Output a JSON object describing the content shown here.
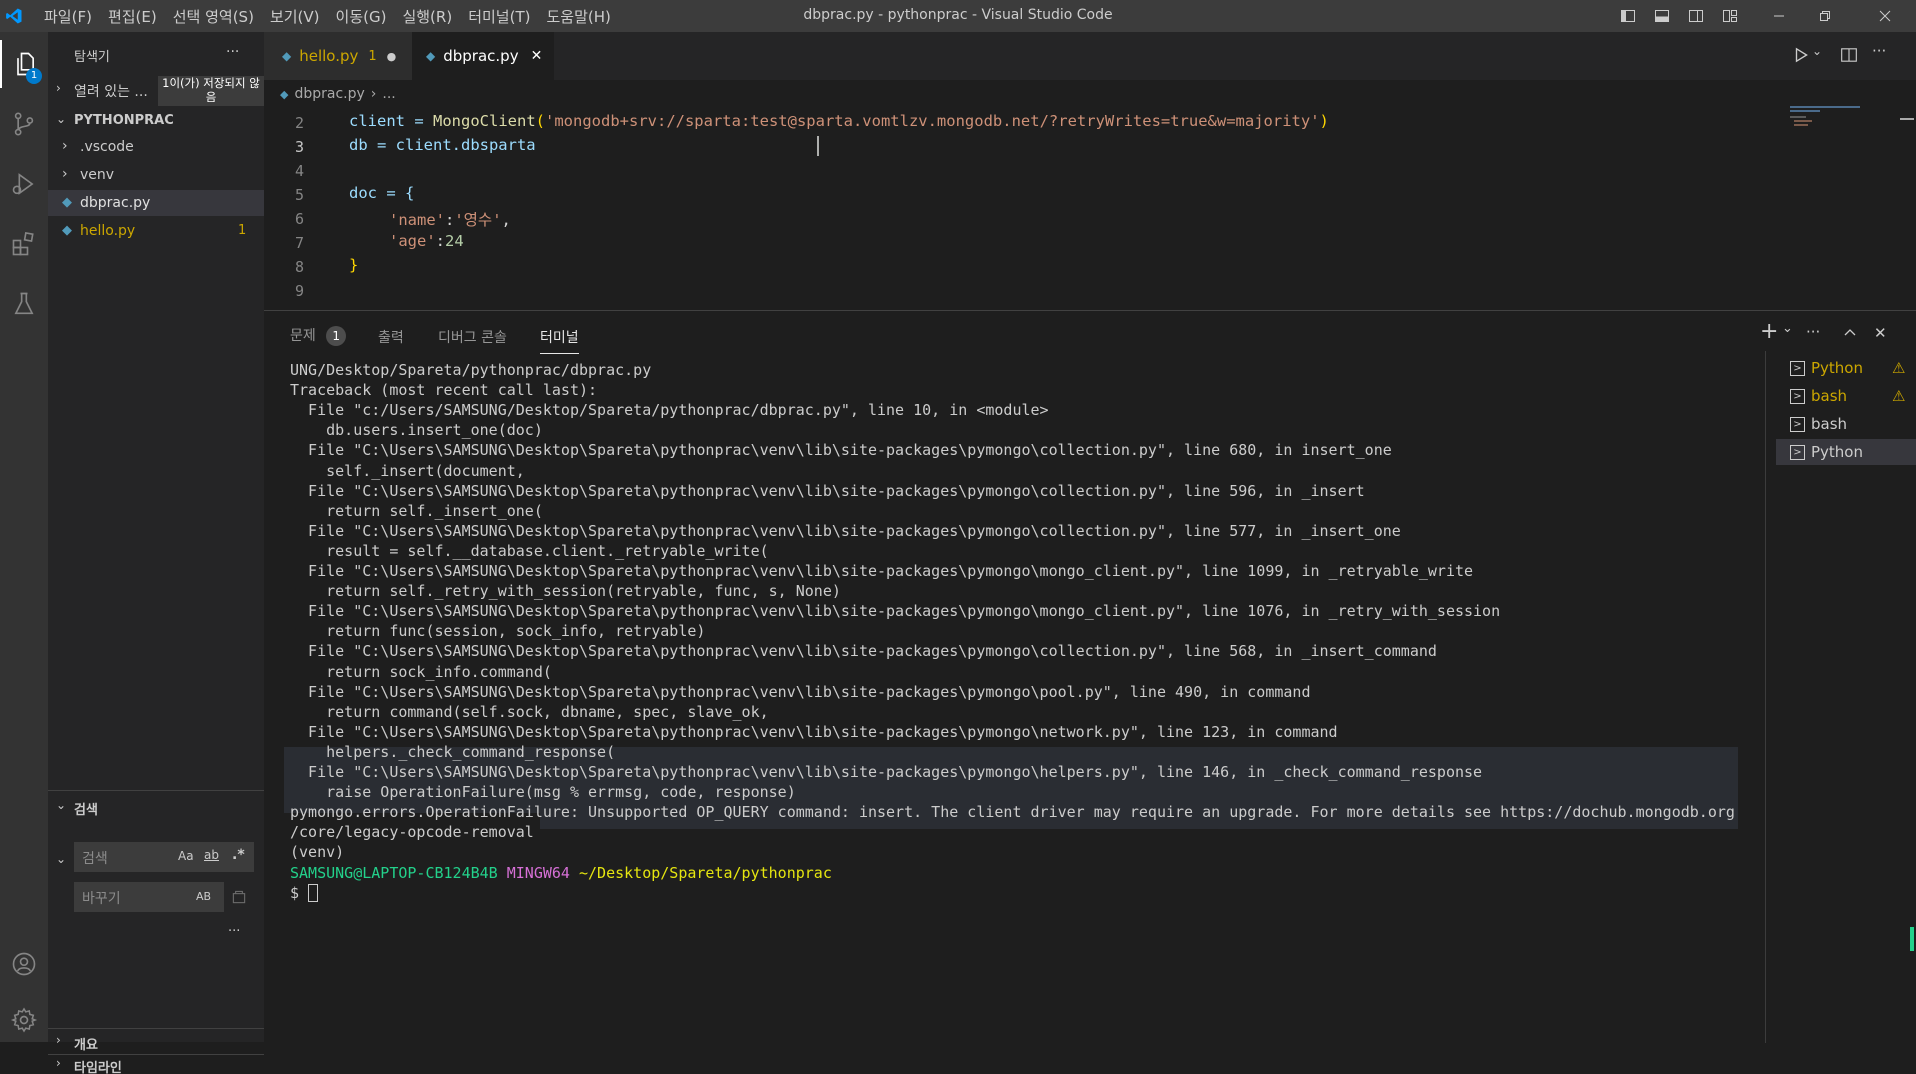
{
  "titlebar": {
    "menus": [
      "파일(F)",
      "편집(E)",
      "선택 영역(S)",
      "보기(V)",
      "이동(G)",
      "실행(R)",
      "터미널(T)",
      "도움말(H)"
    ],
    "title": "dbprac.py - pythonprac - Visual Studio Code"
  },
  "activity": {
    "explorer_badge": "1"
  },
  "sidebar": {
    "header": "탐색기",
    "more": "···",
    "open_editors": "열려 있는 ...",
    "unsaved_tooltip": "1이(가) 저장되지 않음",
    "project": "PYTHONPRAC",
    "items": [
      {
        "label": ".vscode"
      },
      {
        "label": "venv"
      },
      {
        "label": "dbprac.py"
      },
      {
        "label": "hello.py",
        "badge": "1"
      }
    ],
    "search": {
      "title": "검색",
      "search_placeholder": "검색",
      "replace_placeholder": "바꾸기",
      "case_label": "Aa",
      "word_label": "ab",
      "regex_label": ".*",
      "preserve_label": "AB",
      "more": "···"
    },
    "outline": "개요",
    "timeline": "타임라인"
  },
  "tabs": [
    {
      "label": "hello.py",
      "badge": "1",
      "modified": "●"
    },
    {
      "label": "dbprac.py",
      "close": "✕"
    }
  ],
  "breadcrumb": {
    "file": "dbprac.py",
    "rest": "..."
  },
  "editor": {
    "lines": [
      {
        "n": "2",
        "a": "client = ",
        "b": "MongoClient",
        "c": "(",
        "d": "'mongodb+srv://sparta:test@sparta.vomtlzv.mongodb.net/?retryWrites=true&w=majority'",
        "e": ")"
      },
      {
        "n": "3",
        "text": "db = client.dbsparta"
      },
      {
        "n": "4"
      },
      {
        "n": "5",
        "text": "doc = {"
      },
      {
        "n": "6",
        "key": "'name'",
        "sep": ":",
        "val": "'영수'",
        "tail": ","
      },
      {
        "n": "7",
        "key": "'age'",
        "sep": ":",
        "val": "24"
      },
      {
        "n": "8",
        "text": "}"
      },
      {
        "n": "9"
      }
    ]
  },
  "panel": {
    "tabs": [
      "문제",
      "출력",
      "디버그 콘솔",
      "터미널"
    ],
    "problems_badge": "1",
    "actions": {
      "add": "+",
      "chevron": "⌄",
      "more": "···",
      "maximize": "^",
      "close": "✕"
    },
    "terminal_lines": [
      "UNG/Desktop/Spareta/pythonprac/dbprac.py",
      "Traceback (most recent call last):",
      "  File \"c:/Users/SAMSUNG/Desktop/Spareta/pythonprac/dbprac.py\", line 10, in <module>",
      "    db.users.insert_one(doc)",
      "  File \"C:\\Users\\SAMSUNG\\Desktop\\Spareta\\pythonprac\\venv\\lib\\site-packages\\pymongo\\collection.py\", line 680, in insert_one",
      "    self._insert(document,",
      "  File \"C:\\Users\\SAMSUNG\\Desktop\\Spareta\\pythonprac\\venv\\lib\\site-packages\\pymongo\\collection.py\", line 596, in _insert",
      "    return self._insert_one(",
      "  File \"C:\\Users\\SAMSUNG\\Desktop\\Spareta\\pythonprac\\venv\\lib\\site-packages\\pymongo\\collection.py\", line 577, in _insert_one",
      "    result = self.__database.client._retryable_write(",
      "  File \"C:\\Users\\SAMSUNG\\Desktop\\Spareta\\pythonprac\\venv\\lib\\site-packages\\pymongo\\mongo_client.py\", line 1099, in _retryable_write",
      "    return self._retry_with_session(retryable, func, s, None)",
      "  File \"C:\\Users\\SAMSUNG\\Desktop\\Spareta\\pythonprac\\venv\\lib\\site-packages\\pymongo\\mongo_client.py\", line 1076, in _retry_with_session",
      "    return func(session, sock_info, retryable)",
      "  File \"C:\\Users\\SAMSUNG\\Desktop\\Spareta\\pythonprac\\venv\\lib\\site-packages\\pymongo\\collection.py\", line 568, in _insert_command",
      "    return sock_info.command(",
      "  File \"C:\\Users\\SAMSUNG\\Desktop\\Spareta\\pythonprac\\venv\\lib\\site-packages\\pymongo\\pool.py\", line 490, in command",
      "    return command(self.sock, dbname, spec, slave_ok,",
      "  File \"C:\\Users\\SAMSUNG\\Desktop\\Spareta\\pythonprac\\venv\\lib\\site-packages\\pymongo\\network.py\", line 123, in command",
      "    helpers._check_command_response(",
      "  File \"C:\\Users\\SAMSUNG\\Desktop\\Spareta\\pythonprac\\venv\\lib\\site-packages\\pymongo\\helpers.py\", line 146, in _check_command_response",
      "    raise OperationFailure(msg % errmsg, code, response)",
      "pymongo.errors.OperationFailure: Unsupported OP_QUERY command: insert. The client driver may require an upgrade. For more details see https://dochub.mongodb.org",
      "/core/legacy-opcode-removal",
      "(venv)"
    ],
    "prompt": {
      "user": "SAMSUNG@LAPTOP-CB124B4B",
      "env": "MINGW64",
      "path": "~/Desktop/Spareta/pythonprac",
      "symbol": "$"
    },
    "terminals": [
      {
        "name": "Python",
        "warn": true
      },
      {
        "name": "bash",
        "warn": true
      },
      {
        "name": "bash",
        "warn": false
      },
      {
        "name": "Python",
        "warn": false
      }
    ]
  },
  "colors": {
    "accent": "#007acc",
    "warning": "#cca700",
    "string": "#ce9178",
    "function": "#dcdcaa",
    "variable": "#9cdcfe",
    "number": "#b5cea8",
    "green": "#23d18b",
    "magenta": "#d670d6",
    "yellow": "#e5e510"
  }
}
